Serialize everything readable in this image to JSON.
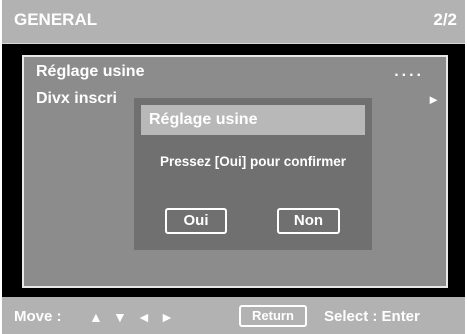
{
  "header": {
    "title": "GENERAL",
    "page": "2/2"
  },
  "menu": {
    "items": [
      {
        "label": "Réglage usine",
        "value": "....",
        "arrow": ""
      },
      {
        "label": "Divx inscri",
        "value": "",
        "arrow": "►"
      }
    ]
  },
  "dialog": {
    "title": "Réglage usine",
    "message": "Pressez [Oui] pour confirmer",
    "buttons": {
      "yes": "Oui",
      "no": "Non"
    }
  },
  "footer": {
    "move_label": "Move :",
    "arrows": {
      "up": "▲",
      "down": "▼",
      "left": "◄",
      "right": "►"
    },
    "return_label": "Return",
    "select_label": "Select :  Enter"
  },
  "colors": {
    "header_bg": "#b2b2b2",
    "panel_bg": "#8c8c8c",
    "dialog_bg": "#707070",
    "dialog_title_bg": "#b8b8b8",
    "text": "#ffffff",
    "screen_bg": "#000000"
  }
}
